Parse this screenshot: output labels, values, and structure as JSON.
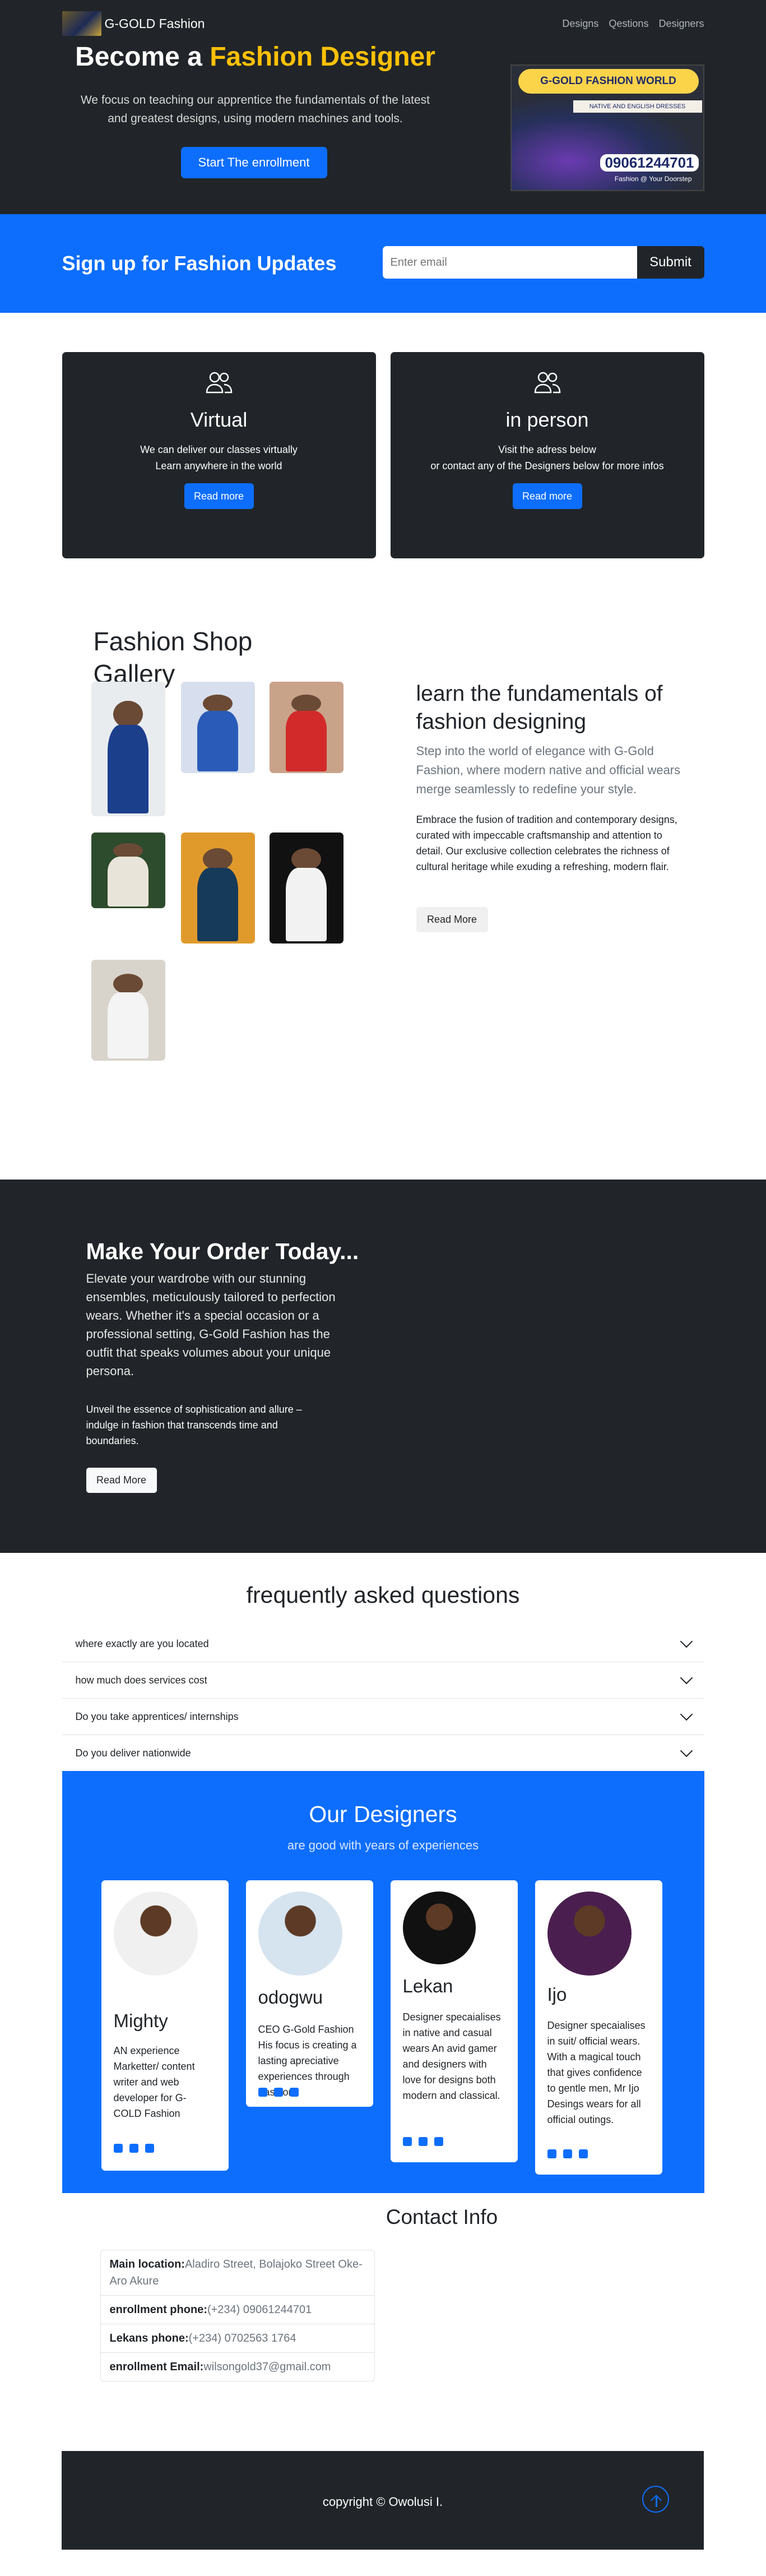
{
  "nav": {
    "brand": "G-GOLD Fashion",
    "links": [
      "Designs",
      "Qestions",
      "Designers"
    ]
  },
  "hero": {
    "title_pre": "Become a ",
    "title_highlight": "Fashion Designer",
    "text": "We focus on teaching our apprentice the fundamentals of the latest and greatest designs, using modern machines and tools.",
    "button": "Start The enrollment",
    "poster": {
      "heading": "G-GOLD FASHION WORLD",
      "sub": "NATIVE AND ENGLISH DRESSES",
      "phone": "09061244701",
      "footer": "Fashion @ Your Doorstep"
    }
  },
  "signup": {
    "title": "Sign up for Fashion Updates",
    "placeholder": "Enter email",
    "button": "Submit"
  },
  "cards": [
    {
      "title": "Virtual",
      "line1": "We can deliver our classes virtually",
      "line2": "Learn anywhere in the world",
      "button": "Read more"
    },
    {
      "title": "in person",
      "line1": "Visit the adress below",
      "line2": "or contact any of the Designers below for more infos",
      "button": "Read more"
    }
  ],
  "gallery": {
    "title": "Fashion Shop Gallery",
    "heading": "learn the fundamentals of fashion designing",
    "lead": "Step into the world of elegance with G-Gold Fashion, where modern native and official wears merge seamlessly to redefine your style.",
    "body": "Embrace the fusion of tradition and contemporary designs, curated with impeccable craftsmanship and attention to detail. Our exclusive collection celebrates the richness of cultural heritage while exuding a refreshing, modern flair.",
    "button": "Read More"
  },
  "order": {
    "title": "Make Your Order Today...",
    "lead": "Elevate your wardrobe with our stunning ensembles, meticulously tailored to perfection wears. Whether it's a special occasion or a professional setting, G-Gold Fashion has the outfit that speaks volumes about your unique persona.",
    "body": "Unveil the essence of sophistication and allure – indulge in fashion that transcends time and boundaries.",
    "button": "Read More"
  },
  "faq": {
    "title": "frequently asked questions",
    "items": [
      "where exactly are you located",
      "how much does services cost",
      "Do you take apprentices/ internships",
      "Do you deliver nationwide"
    ]
  },
  "designers": {
    "title": "Our Designers",
    "subtitle": "are good with years of experiences",
    "people": [
      {
        "name": "Mighty",
        "bio": "AN experience Marketter/ content writer and web developer for G-COLD Fashion"
      },
      {
        "name": "odogwu",
        "bio": "CEO G-Gold Fashion His focus is creating a lasting apreciative experiences through Fashion ."
      },
      {
        "name": "Lekan",
        "bio": "Designer specaialises in native and casual wears An avid gamer and designers with love for designs both modern and classical."
      },
      {
        "name": "Ijo",
        "bio": "Designer specaialises in suit/ official wears. With a magical touch that gives confidence to gentle men, Mr Ijo Desings wears for all official outings."
      }
    ]
  },
  "contact": {
    "title": "Contact Info",
    "rows": [
      {
        "label": "Main location:",
        "value": "Aladiro Street, Bolajoko Street Oke-Aro Akure"
      },
      {
        "label": "enrollment phone:",
        "value": "(+234) 09061244701"
      },
      {
        "label": "Lekans phone:",
        "value": "(+234) 0702563 1764"
      },
      {
        "label": "enrollment Email:",
        "value": "wilsongold37@gmail.com"
      }
    ]
  },
  "footer": {
    "text": "copyright © Owolusi I."
  }
}
